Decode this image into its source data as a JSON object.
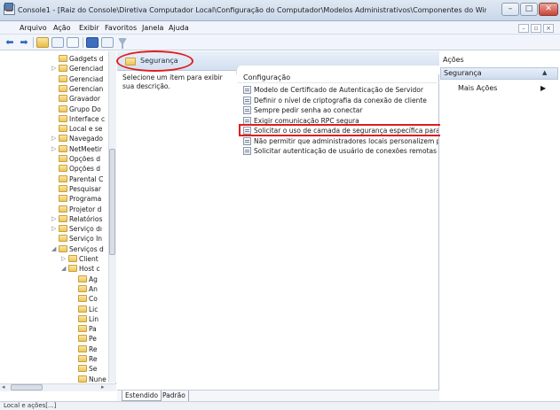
{
  "window": {
    "title": "Console1 - [Raiz do Console\\Diretiva Computador Local\\Configuração do Computador\\Modelos Administrativos\\Componentes do Windows\\Serviços d...",
    "controls": {
      "minimize": "–",
      "maximize": "□",
      "close": "✕"
    }
  },
  "menu": {
    "items": [
      "Arquivo",
      "Ação",
      "Exibir",
      "Favoritos",
      "Janela",
      "Ajuda"
    ],
    "mdi": {
      "minimize": "–",
      "restore": "▫",
      "close": "×"
    }
  },
  "toolbar": {
    "icons": [
      "back-arrow-icon",
      "forward-arrow-icon",
      "up-folder-icon",
      "show-hide-tree-icon",
      "export-list-icon",
      "help-icon",
      "properties-icon",
      "filter-icon"
    ],
    "back": "⬅",
    "forward": "➡"
  },
  "tree": {
    "items": [
      {
        "label": "Gadgets d",
        "expander": ""
      },
      {
        "label": "Gerenciad",
        "expander": "▷"
      },
      {
        "label": "Gerenciad",
        "expander": ""
      },
      {
        "label": "Gerencian",
        "expander": ""
      },
      {
        "label": "Gravador",
        "expander": ""
      },
      {
        "label": "Grupo Do",
        "expander": ""
      },
      {
        "label": "Interface c",
        "expander": ""
      },
      {
        "label": "Local e se",
        "expander": ""
      },
      {
        "label": "Navegado",
        "expander": "▷"
      },
      {
        "label": "NetMeetir",
        "expander": "▷"
      },
      {
        "label": "Opções d",
        "expander": ""
      },
      {
        "label": "Opções d",
        "expander": ""
      },
      {
        "label": "Parental C",
        "expander": ""
      },
      {
        "label": "Pesquisar",
        "expander": ""
      },
      {
        "label": "Programa",
        "expander": ""
      },
      {
        "label": "Projetor d",
        "expander": ""
      },
      {
        "label": "Relatórios",
        "expander": "▷"
      },
      {
        "label": "Serviço dı",
        "expander": "▷"
      },
      {
        "label": "Serviço In",
        "expander": ""
      },
      {
        "label": "Serviços d",
        "expander": "◢"
      },
      {
        "label": "Client",
        "expander": "▷"
      },
      {
        "label": "Host c",
        "expander": "◢"
      },
      {
        "label": "Ag",
        "expander": ""
      },
      {
        "label": "An",
        "expander": ""
      },
      {
        "label": "Co",
        "expander": ""
      },
      {
        "label": "Lic",
        "expander": ""
      },
      {
        "label": "Lin",
        "expander": ""
      },
      {
        "label": "Pa",
        "expander": ""
      },
      {
        "label": "Pe",
        "expander": ""
      },
      {
        "label": "Re",
        "expander": ""
      },
      {
        "label": "Re",
        "expander": ""
      },
      {
        "label": "Se",
        "expander": ""
      },
      {
        "label": "Nune",
        "expander": ""
      }
    ],
    "hscroll_left": "◂",
    "hscroll_right": "▸"
  },
  "center": {
    "section_title": "Segurança",
    "description": "Selecione um item para exibir sua descrição.",
    "column_header": "Configuração",
    "settings": [
      "Modelo de Certificado de Autenticação de Servidor",
      "Definir o nível de criptografia da conexão de cliente",
      "Sempre pedir senha ao conectar",
      "Exigir comunicação RPC segura",
      "Solicitar o uso de camada de segurança específica para con...",
      "Não permitir que administradores locais personalizem perm",
      "Solicitar autenticação de usuário de conexões remotas usan..."
    ],
    "tabs": [
      "Estendido",
      "Padrão"
    ]
  },
  "actions": {
    "header": "Ações",
    "section": "Segurança",
    "section_caret": "▲",
    "more": "Mais Ações",
    "more_caret": "▶"
  },
  "status": {
    "text": "Local e ações[...]"
  },
  "colors": {
    "annotation": "#e01e1e",
    "folder": "#eec55b",
    "header_gradient": "#d3e0f0"
  }
}
